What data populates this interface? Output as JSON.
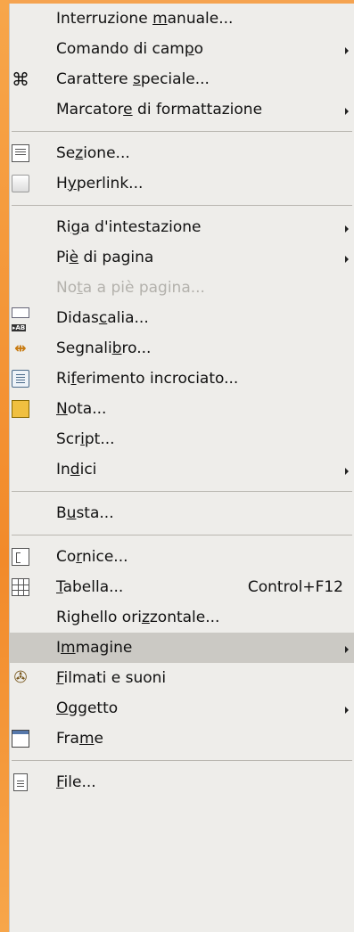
{
  "menu": {
    "items": [
      {
        "type": "item",
        "name": "menu-item-manual-break",
        "pre": "Interruzione ",
        "mn": "m",
        "post": "anuale...",
        "icon": "none"
      },
      {
        "type": "item",
        "name": "menu-item-field-command",
        "pre": "Comando di cam",
        "mn": "p",
        "post": "o",
        "submenu": true,
        "icon": "none"
      },
      {
        "type": "item",
        "name": "menu-item-special-character",
        "pre": "Carattere ",
        "mn": "s",
        "post": "peciale...",
        "icon": "command-key-icon"
      },
      {
        "type": "item",
        "name": "menu-item-formatting-mark",
        "pre": "Marcator",
        "mn": "e",
        "post": " di formattazione",
        "submenu": true,
        "icon": "none"
      },
      {
        "type": "sep"
      },
      {
        "type": "item",
        "name": "menu-item-section",
        "pre": "Se",
        "mn": "z",
        "post": "ione...",
        "icon": "section-icon"
      },
      {
        "type": "item",
        "name": "menu-item-hyperlink",
        "pre": "H",
        "mn": "y",
        "post": "perlink...",
        "icon": "hyperlink-icon"
      },
      {
        "type": "sep"
      },
      {
        "type": "item",
        "name": "menu-item-header",
        "pre": "Ri",
        "mn": "g",
        "post": "a d'intestazione",
        "submenu": true,
        "icon": "none"
      },
      {
        "type": "item",
        "name": "menu-item-footer",
        "pre": "Pi",
        "mn": "è",
        "post": " di pagina",
        "submenu": true,
        "icon": "none"
      },
      {
        "type": "item",
        "name": "menu-item-footnote",
        "pre": "No",
        "mn": "t",
        "post": "a a piè pagina...",
        "disabled": true,
        "icon": "none"
      },
      {
        "type": "item",
        "name": "menu-item-caption",
        "pre": "Didas",
        "mn": "c",
        "post": "alia...",
        "icon": "caption-icon"
      },
      {
        "type": "item",
        "name": "menu-item-bookmark",
        "pre": "Segnali",
        "mn": "b",
        "post": "ro...",
        "icon": "bookmark-icon"
      },
      {
        "type": "item",
        "name": "menu-item-cross-reference",
        "pre": "Ri",
        "mn": "f",
        "post": "erimento incrociato...",
        "icon": "cross-reference-icon"
      },
      {
        "type": "item",
        "name": "menu-item-note",
        "pre": "",
        "mn": "N",
        "post": "ota...",
        "icon": "note-icon"
      },
      {
        "type": "item",
        "name": "menu-item-script",
        "pre": "Scr",
        "mn": "i",
        "post": "pt...",
        "icon": "none"
      },
      {
        "type": "item",
        "name": "menu-item-indexes",
        "pre": "In",
        "mn": "d",
        "post": "ici",
        "submenu": true,
        "icon": "none"
      },
      {
        "type": "sep"
      },
      {
        "type": "item",
        "name": "menu-item-envelope",
        "pre": "B",
        "mn": "u",
        "post": "sta...",
        "icon": "none"
      },
      {
        "type": "sep"
      },
      {
        "type": "item",
        "name": "menu-item-frame-dialog",
        "pre": "Co",
        "mn": "r",
        "post": "nice...",
        "icon": "frame-icon"
      },
      {
        "type": "item",
        "name": "menu-item-table",
        "pre": "",
        "mn": "T",
        "post": "abella...",
        "shortcut": "Control+F12",
        "icon": "table-icon"
      },
      {
        "type": "item",
        "name": "menu-item-horizontal-ruler",
        "pre": "Righello ori",
        "mn": "z",
        "post": "zontale...",
        "icon": "none"
      },
      {
        "type": "item",
        "name": "menu-item-picture",
        "pre": "I",
        "mn": "m",
        "post": "magine",
        "submenu": true,
        "highlighted": true,
        "icon": "none"
      },
      {
        "type": "item",
        "name": "menu-item-movies-sounds",
        "pre": "",
        "mn": "F",
        "post": "ilmati e suoni",
        "icon": "media-icon"
      },
      {
        "type": "item",
        "name": "menu-item-object",
        "pre": "",
        "mn": "O",
        "post": "ggetto",
        "submenu": true,
        "icon": "none"
      },
      {
        "type": "item",
        "name": "menu-item-floating-frame",
        "pre": "Fra",
        "mn": "m",
        "post": "e",
        "icon": "window-icon"
      },
      {
        "type": "sep"
      },
      {
        "type": "item",
        "name": "menu-item-file",
        "pre": "",
        "mn": "F",
        "post": "ile...",
        "icon": "file-icon"
      }
    ]
  }
}
